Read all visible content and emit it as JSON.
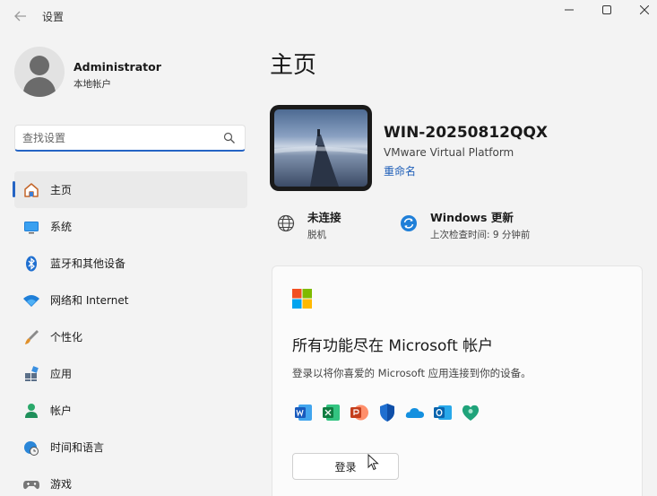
{
  "window": {
    "title": "设置"
  },
  "profile": {
    "name": "Administrator",
    "account_type": "本地帐户"
  },
  "search": {
    "placeholder": "查找设置"
  },
  "nav": {
    "items": [
      {
        "label": "主页",
        "icon": "home-icon",
        "active": true
      },
      {
        "label": "系统",
        "icon": "monitor-icon"
      },
      {
        "label": "蓝牙和其他设备",
        "icon": "bluetooth-icon"
      },
      {
        "label": "网络和 Internet",
        "icon": "wifi-icon"
      },
      {
        "label": "个性化",
        "icon": "brush-icon"
      },
      {
        "label": "应用",
        "icon": "apps-icon"
      },
      {
        "label": "帐户",
        "icon": "person-icon"
      },
      {
        "label": "时间和语言",
        "icon": "clock-globe-icon"
      },
      {
        "label": "游戏",
        "icon": "gamepad-icon"
      }
    ]
  },
  "main": {
    "page_title": "主页",
    "device": {
      "name": "WIN-20250812QQX",
      "model": "VMware Virtual Platform",
      "rename_label": "重命名"
    },
    "status": {
      "network": {
        "title": "未连接",
        "subtitle": "脱机"
      },
      "update": {
        "title": "Windows 更新",
        "subtitle": "上次检查时间: 9 分钟前"
      }
    },
    "ms_card": {
      "title": "所有功能尽在 Microsoft 帐户",
      "description": "登录以将你喜爱的 Microsoft 应用连接到你的设备。",
      "signin_label": "登录",
      "apps": [
        "word-icon",
        "excel-icon",
        "powerpoint-icon",
        "defender-icon",
        "onedrive-icon",
        "outlook-icon",
        "family-safety-icon"
      ]
    }
  },
  "colors": {
    "accent": "#2564c4",
    "link": "#1f5fb8",
    "background": "#f3f3f3"
  }
}
